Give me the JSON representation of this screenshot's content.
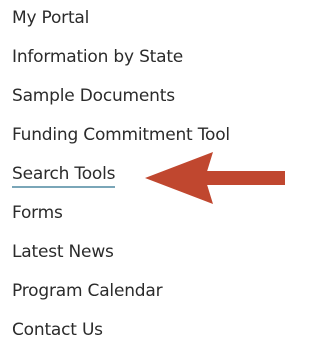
{
  "nav": {
    "items": [
      {
        "label": "My Portal"
      },
      {
        "label": "Information by State"
      },
      {
        "label": "Sample Documents"
      },
      {
        "label": "Funding Commitment Tool"
      },
      {
        "label": "Search Tools",
        "active": true
      },
      {
        "label": "Forms"
      },
      {
        "label": "Latest News"
      },
      {
        "label": "Program Calendar"
      },
      {
        "label": "Contact Us"
      }
    ]
  },
  "annotation": {
    "arrow_color": "#c0472f",
    "underline_color": "#7aa6b8"
  }
}
